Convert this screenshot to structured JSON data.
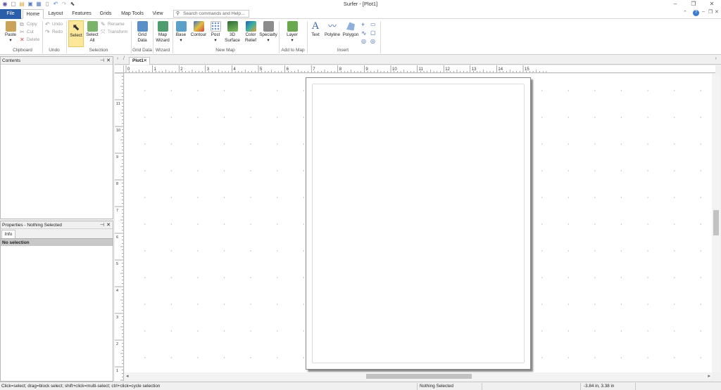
{
  "window": {
    "title": "Surfer - [Plot1]"
  },
  "ribbon_tabs": [
    "File",
    "Home",
    "Layout",
    "Features",
    "Grids",
    "Map Tools",
    "View"
  ],
  "search": {
    "placeholder": "Search commands and Help..."
  },
  "groups": {
    "clipboard": {
      "label": "Clipboard",
      "paste": "Paste",
      "copy": "Copy",
      "cut": "Cut",
      "delete": "Delete"
    },
    "undo": {
      "label": "Undo",
      "undo": "Undo",
      "redo": "Redo"
    },
    "selection": {
      "label": "Selection",
      "select": "Select",
      "select_all_1": "Select",
      "select_all_2": "All",
      "rename": "Rename",
      "transform": "Transform"
    },
    "grid_data": {
      "label": "Grid Data",
      "btn_1": "Grid",
      "btn_2": "Data"
    },
    "wizard": {
      "label": "Wizard",
      "btn_1": "Map",
      "btn_2": "Wizard"
    },
    "new_map": {
      "label": "New Map",
      "base": "Base",
      "contour": "Contour",
      "post": "Post",
      "surface_1": "3D",
      "surface_2": "Surface",
      "color_1": "Color",
      "color_2": "Relief",
      "specialty": "Specialty"
    },
    "add_to_map": {
      "label": "Add to Map",
      "layer": "Layer"
    },
    "insert": {
      "label": "Insert",
      "text": "Text",
      "polyline": "Polyline",
      "polygon": "Polygon"
    }
  },
  "panels": {
    "contents": {
      "title": "Contents"
    },
    "properties": {
      "title": "Properties - Nothing Selected",
      "tab_info": "Info",
      "no_selection": "No selection"
    }
  },
  "document": {
    "tab": "Plot1"
  },
  "ruler": {
    "h_labels": [
      "0",
      "1",
      "2",
      "3",
      "4",
      "5",
      "6",
      "7",
      "8",
      "9",
      "10",
      "11",
      "12",
      "13",
      "14",
      "15"
    ],
    "v_labels": [
      "11",
      "10",
      "9",
      "8",
      "7",
      "6",
      "5",
      "4",
      "3",
      "2",
      "1"
    ]
  },
  "status": {
    "hint": "Click=select; drag=block select; shift+click=multi-select; ctrl+click=cycle selection",
    "selection": "Nothing Selected",
    "coords": "-3.84 in, 3.38 in"
  },
  "colors": {
    "file_tab": "#2a5ea8",
    "select_highlight": "#fce79a"
  },
  "icons": [
    "app-icon",
    "new-icon",
    "open-icon",
    "save-icon",
    "undo-icon",
    "redo-icon",
    "pointer-icon",
    "search-icon",
    "help-icon",
    "minimize-icon",
    "restore-icon",
    "close-icon"
  ]
}
